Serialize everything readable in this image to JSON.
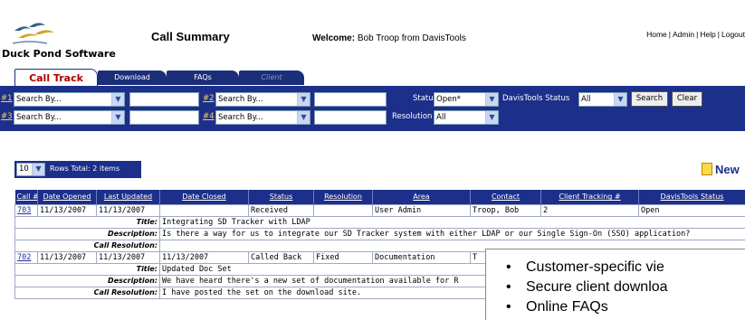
{
  "header": {
    "brand": "Duck Pond Software",
    "page_title": "Call Summary",
    "welcome_label": "Welcome:",
    "welcome_user": "Bob Troop from DavisTools",
    "links": [
      "Home",
      "Admin",
      "Help",
      "Logout"
    ]
  },
  "tabs": [
    {
      "label": "Call Track",
      "active": true
    },
    {
      "label": "Download",
      "active": false
    },
    {
      "label": "FAQs",
      "active": false
    },
    {
      "label": "Client",
      "active": false,
      "disabled": true
    }
  ],
  "search": {
    "row1": {
      "num": "#1",
      "field": "Search By...",
      "num2": "#2",
      "field2": "Search By...",
      "status_label": "Status",
      "status_value": "Open*",
      "dt_status_label": "DavisTools Status",
      "dt_status_value": "All"
    },
    "row2": {
      "num": "#3",
      "field": "Search By...",
      "num2": "#4",
      "field2": "Search By...",
      "resolution_label": "Resolution",
      "resolution_value": "All"
    },
    "search_button": "Search",
    "clear_button": "Clear"
  },
  "rows_bar": {
    "rows_value": "10",
    "rows_text": "Rows  Total: 2 items"
  },
  "new_button": "New",
  "table": {
    "columns": [
      "Call #",
      "Date Opened",
      "Last Updated",
      "Date Closed",
      "Status",
      "Resolution",
      "Area",
      "Contact",
      "Client Tracking #",
      "DavisTools Status"
    ],
    "records": [
      {
        "id": "703",
        "opened": "11/13/2007",
        "updated": "11/13/2007",
        "closed": "",
        "status": "Received",
        "resolution": "",
        "area": "User Admin",
        "contact": "Troop, Bob",
        "tracking": "2",
        "dt_status": "Open",
        "title": "Integrating SD Tracker with LDAP",
        "description": "Is there a way for us to integrate our SD Tracker system with either LDAP or our Single Sign-On (SSO) application?",
        "call_resolution": ""
      },
      {
        "id": "702",
        "opened": "11/13/2007",
        "updated": "11/13/2007",
        "closed": "11/13/2007",
        "status": "Called Back",
        "resolution": "Fixed",
        "area": "Documentation",
        "contact": "T",
        "tracking": "",
        "dt_status": "",
        "title": "Updated Doc Set",
        "description": "We have heard there's a new set of documentation available for R",
        "call_resolution": "I have posted the set on the download site."
      }
    ],
    "labels": {
      "title": "Title:",
      "description": "Description:",
      "call_resolution": "Call Resolution:"
    }
  },
  "overlay": {
    "bullets": [
      "Customer-specific vie",
      "Secure client downloa",
      "Online FAQs"
    ]
  },
  "colors": {
    "nav_blue": "#1c2f8a",
    "active_tab_text": "#b00000",
    "link_yellow": "#ffd34d"
  }
}
